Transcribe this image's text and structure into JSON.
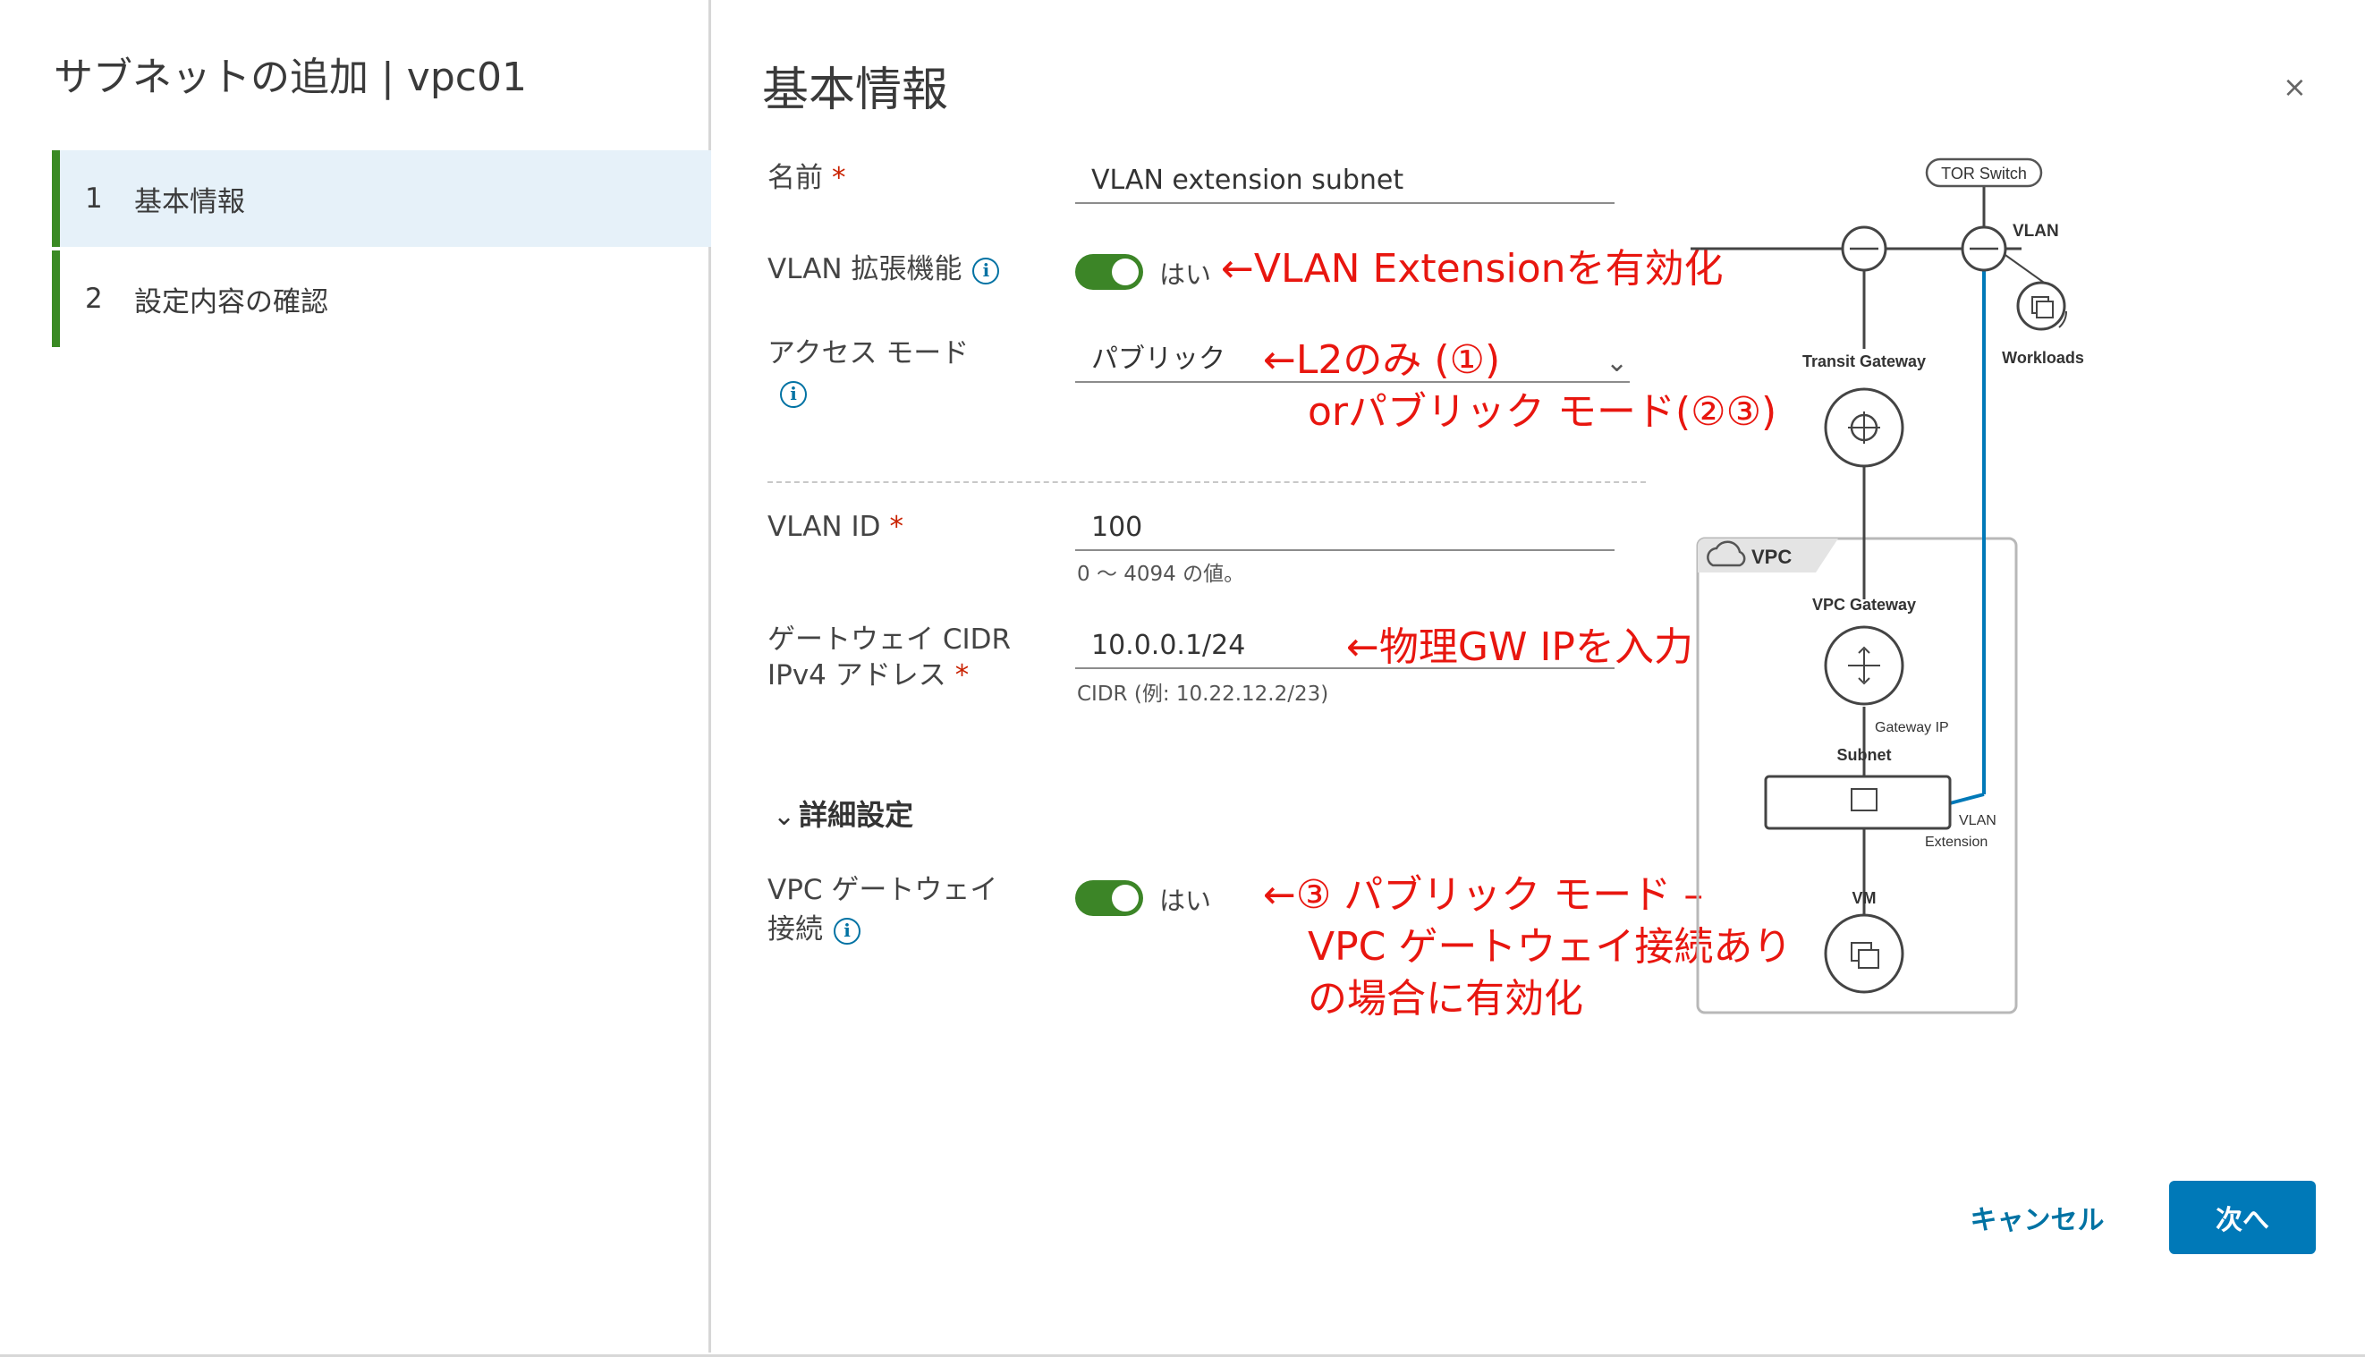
{
  "wizard": {
    "title": "サブネットの追加 | vpc01",
    "steps": [
      {
        "num": "1",
        "label": "基本情報"
      },
      {
        "num": "2",
        "label": "設定内容の確認"
      }
    ]
  },
  "page": {
    "title": "基本情報",
    "close": "×"
  },
  "form": {
    "name_label": "名前",
    "name_value": "VLAN extension subnet",
    "vlan_ext_label": "VLAN 拡張機能",
    "vlan_ext_toggle": "はい",
    "access_mode_label": "アクセス モード",
    "access_mode_value": "パブリック",
    "vlan_id_label": "VLAN ID",
    "vlan_id_value": "100",
    "vlan_id_hint": "0 〜 4094 の値。",
    "gw_label_line1": "ゲートウェイ CIDR",
    "gw_label_line2": "IPv4 アドレス",
    "gw_value": "10.0.0.1/24",
    "gw_hint": "CIDR (例: 10.22.12.2/23)",
    "advanced": "詳細設定",
    "vpc_gw_label_line1": "VPC ゲートウェイ",
    "vpc_gw_label_line2": "接続",
    "vpc_gw_toggle": "はい",
    "required_mark": "*",
    "info_glyph": "i"
  },
  "annotations": {
    "vlan_ext": "←VLAN Extensionを有効化",
    "access_1": "←L2のみ (①)",
    "access_2": "orパブリック モード(②③)",
    "gw": "←物理GW IPを入力",
    "vpc_1": "←③ パブリック モード –",
    "vpc_2": "VPC ゲートウェイ接続あり",
    "vpc_3": "の場合に有効化"
  },
  "diagram": {
    "tor_switch": "TOR Switch",
    "vlan": "VLAN",
    "transit_gateway": "Transit Gateway",
    "workloads": "Workloads",
    "vpc": "VPC",
    "vpc_gateway": "VPC Gateway",
    "gateway_ip": "Gateway IP",
    "subnet": "Subnet",
    "vlan_ext_line1": "VLAN",
    "vlan_ext_line2": "Extension",
    "vm": "VM"
  },
  "footer": {
    "cancel": "キャンセル",
    "next": "次へ"
  },
  "colors": {
    "accent_green": "#3c8527",
    "primary_blue": "#0079b8",
    "annotation_red": "#e8160f",
    "active_step_bg": "#e6f1f9"
  }
}
